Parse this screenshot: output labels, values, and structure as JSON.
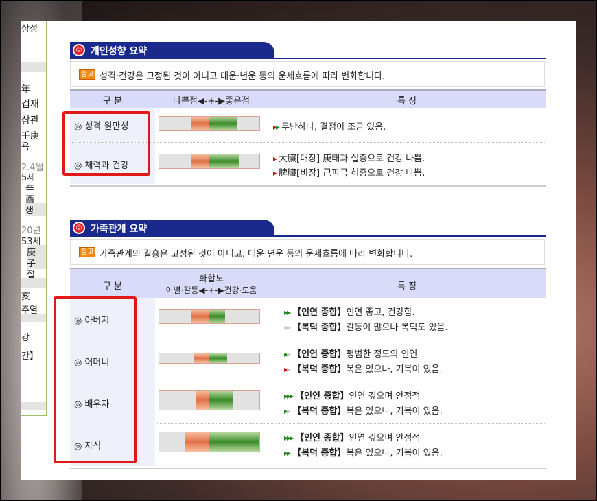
{
  "left_column": {
    "cells": [
      "상성",
      "年",
      "겁재",
      "상관",
      "壬庚",
      "욕",
      "2.4월",
      "5세",
      "辛",
      "酉",
      "생",
      "20년",
      "53세",
      "庚",
      "子",
      "절",
      "亥",
      "주열",
      "강",
      "간】"
    ]
  },
  "personality": {
    "title": "개인성향 요약",
    "note_tag": "참고",
    "note": "성격·건강은 고정된 것이 아니고 대운·년운 등의 운세흐름에 따라 변화합니다.",
    "headers": {
      "category": "구 분",
      "scale": "나쁜점◀-+-▶좋은점",
      "feature": "특 징"
    },
    "rows": [
      {
        "label": "◎ 성격 원만성",
        "bar": {
          "orange_start": 0.32,
          "orange_end": 0.5,
          "green_end": 0.78
        },
        "lines": [
          {
            "arrows": "››",
            "arrow_colors": [
              "red",
              "green"
            ],
            "text": "무난하나, 결점이 조금 있음."
          }
        ]
      },
      {
        "label": "◎ 체력과 건강",
        "bar": {
          "orange_start": 0.32,
          "orange_end": 0.5,
          "green_end": 0.8
        },
        "lines": [
          {
            "arrows": "›",
            "arrow_colors": [
              "red"
            ],
            "text": "大臟[대장] 庚태과 실증으로 건강 나쁨."
          },
          {
            "arrows": "›",
            "arrow_colors": [
              "red"
            ],
            "text": "脾臟[비장] 己파극 허증으로 건강 나쁨."
          }
        ]
      }
    ]
  },
  "family": {
    "title": "가족관계 요약",
    "note_tag": "참고",
    "note": "가족관계의 길흉은 고정된 것이 아니고, 대운·년운 등의 운세흐름에 따라 변화합니다.",
    "headers": {
      "category": "구 분",
      "scale_top": "화합도",
      "scale_bottom": "이별·갈등◀-+-▶건강·도움",
      "feature": "특 징"
    },
    "rows": [
      {
        "label": "◎ 아버지",
        "bar": {
          "orange_start": 0.32,
          "orange_end": 0.5,
          "green_end": 0.66
        },
        "lines": [
          {
            "arrows": "»",
            "arrow_colors": [
              "green",
              "green"
            ],
            "tag": "【인연 종합】",
            "text": "인연 좋고, 건강함."
          },
          {
            "arrows": "»",
            "arrow_colors": [
              "gray",
              "gray"
            ],
            "tag": "【복덕 종합】",
            "text": "갈등이 많으나 복덕도 있음."
          }
        ]
      },
      {
        "label": "◎ 어머니",
        "bar": {
          "orange_start": 0.34,
          "orange_end": 0.5,
          "green_end": 0.68
        },
        "lines": [
          {
            "arrows": "›",
            "arrow_colors": [
              "green",
              "gray"
            ],
            "tag": "【인연 종합】",
            "text": "평범한 정도의 인연"
          },
          {
            "arrows": "›",
            "arrow_colors": [
              "red",
              "gray"
            ],
            "tag": "【복덕 종합】",
            "text": "복은 있으나, 기복이 있음."
          }
        ]
      },
      {
        "label": "◎ 배우자",
        "bar": {
          "orange_start": 0.36,
          "orange_end": 0.5,
          "green_end": 0.74
        },
        "lines": [
          {
            "arrows": "»›",
            "arrow_colors": [
              "green",
              "green",
              "green"
            ],
            "tag": "【인연 종합】",
            "text": "인연 깊으며 안정적"
          },
          {
            "arrows": "›",
            "arrow_colors": [
              "green",
              "gray"
            ],
            "tag": "【복덕 종합】",
            "text": "복은 있으나, 기복이 있음."
          }
        ]
      },
      {
        "label": "◎ 자식",
        "bar": {
          "orange_start": 0.26,
          "orange_end": 0.5,
          "green_end": 1.0
        },
        "lines": [
          {
            "arrows": "»›",
            "arrow_colors": [
              "green",
              "green",
              "green"
            ],
            "tag": "【인연 종합】",
            "text": "인연 깊으며 안정적"
          },
          {
            "arrows": "»",
            "arrow_colors": [
              "green",
              "green"
            ],
            "tag": "【복덕 종합】",
            "text": "복은 있으나, 기복이 있음."
          }
        ]
      }
    ]
  },
  "colors": {
    "header_bar": "#1a2a8c",
    "table_head": "#d8dcf8",
    "highlight_box": "#e01818",
    "orange": "#e07048",
    "green": "#3a8a2a"
  }
}
